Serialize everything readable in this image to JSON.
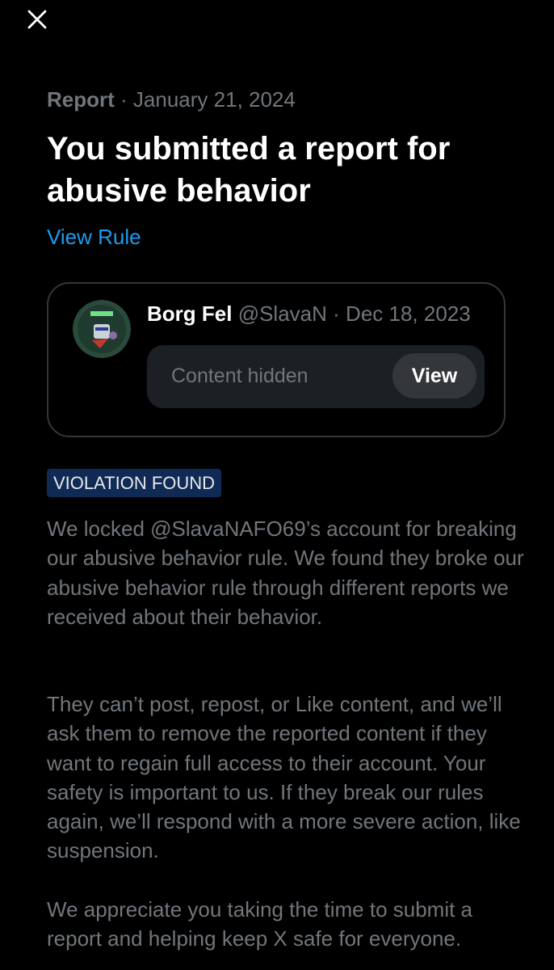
{
  "header": {
    "close_icon": "close-icon"
  },
  "report": {
    "label": "Report",
    "separator": "·",
    "date": "January 21, 2024",
    "title": "You submitted a report for abusive behavior",
    "view_rule_label": "View Rule"
  },
  "post": {
    "avatar_icon": "avatar",
    "author_name": "Borg Fel",
    "author_handle": "@SlavaN",
    "separator": "·",
    "date": "Dec 18, 2023",
    "hidden_text": "Content hidden",
    "view_label": "View"
  },
  "violation": {
    "badge": "VIOLATION FOUND",
    "paragraphs": [
      "We locked @SlavaNAFO69’s account for breaking our abusive behavior rule. We found they broke our abusive behavior rule through different reports we received about their behavior.",
      "They can’t post, repost, or Like content, and we’ll ask them to remove the reported content if they want to regain full access to their account. Your safety is important to us. If they break our rules again, we’ll respond with a more severe action, like suspension.",
      "We appreciate you taking the time to submit a report and helping keep X safe for everyone."
    ]
  },
  "colors": {
    "background": "#000000",
    "primary_text": "#ffffff",
    "secondary_text": "#71767b",
    "link": "#1d9bf0",
    "badge_bg": "#0f2a55",
    "card_border": "#333639"
  }
}
